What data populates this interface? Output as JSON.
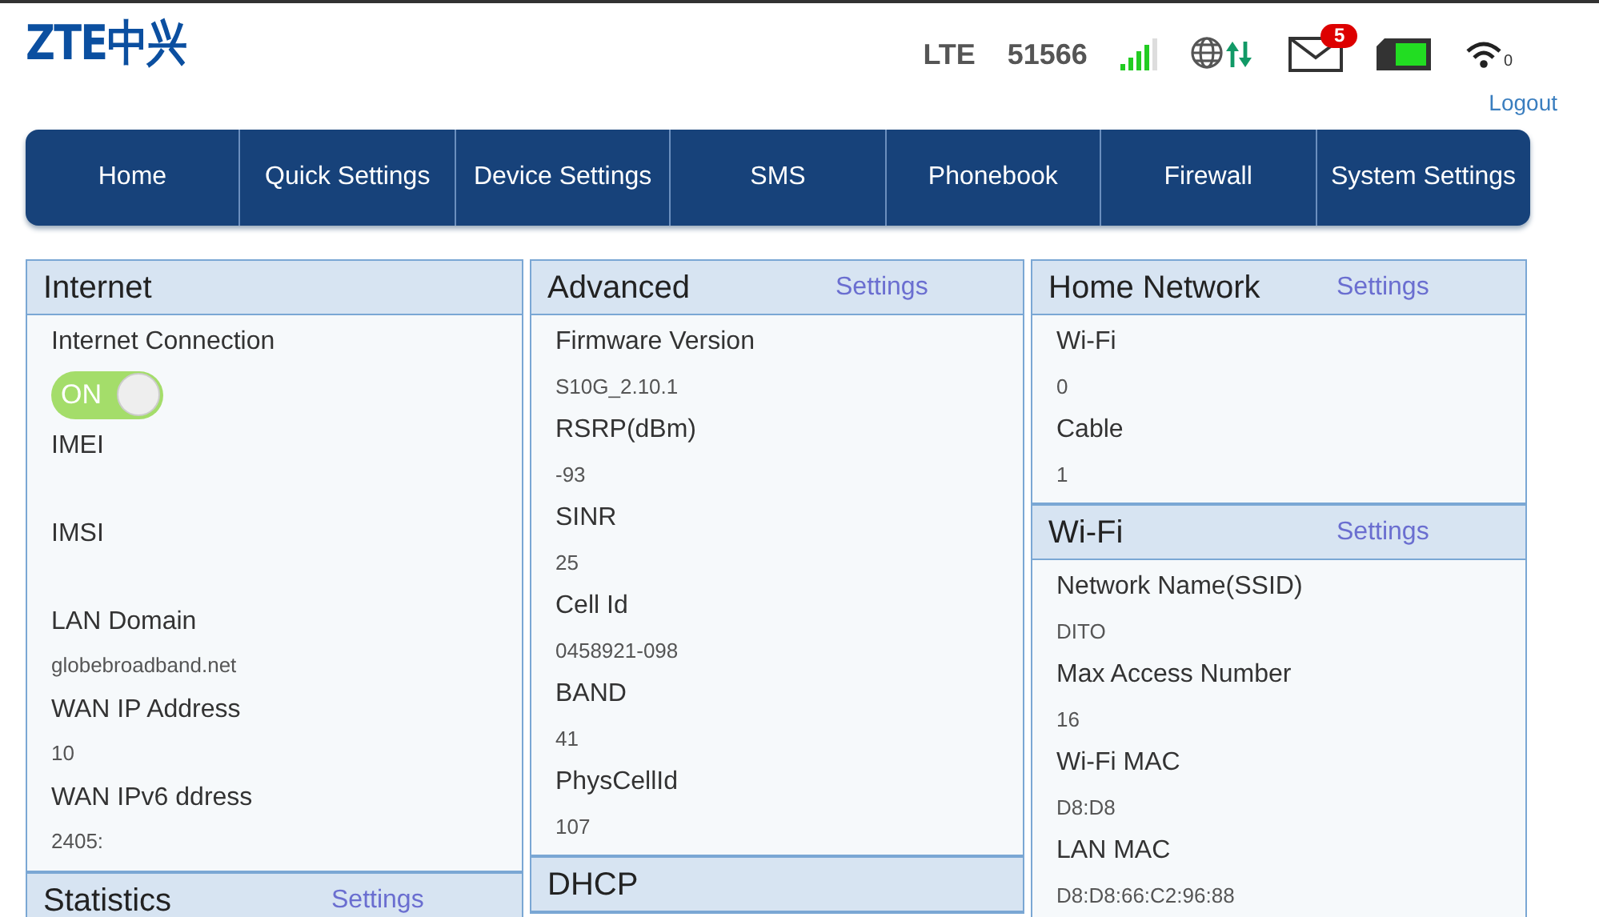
{
  "header": {
    "logo": "ZTE中兴",
    "network_type": "LTE",
    "operator": "51566",
    "unread_messages": "5",
    "wifi_clients": "0",
    "logout": "Logout"
  },
  "nav": [
    {
      "label": "Home"
    },
    {
      "label": "Quick Settings"
    },
    {
      "label": "Device Settings"
    },
    {
      "label": "SMS"
    },
    {
      "label": "Phonebook"
    },
    {
      "label": "Firewall"
    },
    {
      "label": "System Settings"
    }
  ],
  "columns": [
    [
      {
        "title": "Internet",
        "rows": [
          {
            "kind": "field",
            "label": "Internet Connection"
          },
          {
            "kind": "toggle",
            "on": true,
            "text": "ON"
          },
          {
            "kind": "field",
            "label": "IMEI"
          },
          {
            "kind": "field",
            "label": "IMSI"
          },
          {
            "kind": "field",
            "label": "LAN Domain",
            "value": "globebroadband.net"
          },
          {
            "kind": "field",
            "label": "WAN IP Address",
            "value": "10"
          },
          {
            "kind": "field",
            "label": "WAN IPv6 ddress",
            "value": "2405:"
          }
        ]
      },
      {
        "title": "Statistics",
        "link": "Settings"
      }
    ],
    [
      {
        "title": "Advanced",
        "link": "Settings",
        "rows": [
          {
            "kind": "field",
            "label": "Firmware Version",
            "value": "S10G_2.10.1"
          },
          {
            "kind": "field",
            "label": "RSRP(dBm)",
            "value": "-93"
          },
          {
            "kind": "field",
            "label": "SINR",
            "value": "25"
          },
          {
            "kind": "field",
            "label": "Cell Id",
            "value": "0458921-098"
          },
          {
            "kind": "field",
            "label": "BAND",
            "value": "41"
          },
          {
            "kind": "field",
            "label": "PhysCellId",
            "value": "107"
          }
        ]
      },
      {
        "title": "DHCP"
      }
    ],
    [
      {
        "title": "Home Network",
        "link": "Settings",
        "rows": [
          {
            "kind": "field",
            "label": "Wi-Fi",
            "value": "0"
          },
          {
            "kind": "field",
            "label": "Cable",
            "value": "1"
          }
        ]
      },
      {
        "title": "Wi-Fi",
        "link": "Settings",
        "rows": [
          {
            "kind": "field",
            "label": "Network Name(SSID)",
            "value": "DITO"
          },
          {
            "kind": "field",
            "label": "Max Access Number",
            "value": "16"
          },
          {
            "kind": "field",
            "label": "Wi-Fi MAC",
            "value": "D8:D8"
          },
          {
            "kind": "field",
            "label": "LAN MAC",
            "value": "D8:D8:66:C2:96:88"
          }
        ]
      }
    ]
  ]
}
